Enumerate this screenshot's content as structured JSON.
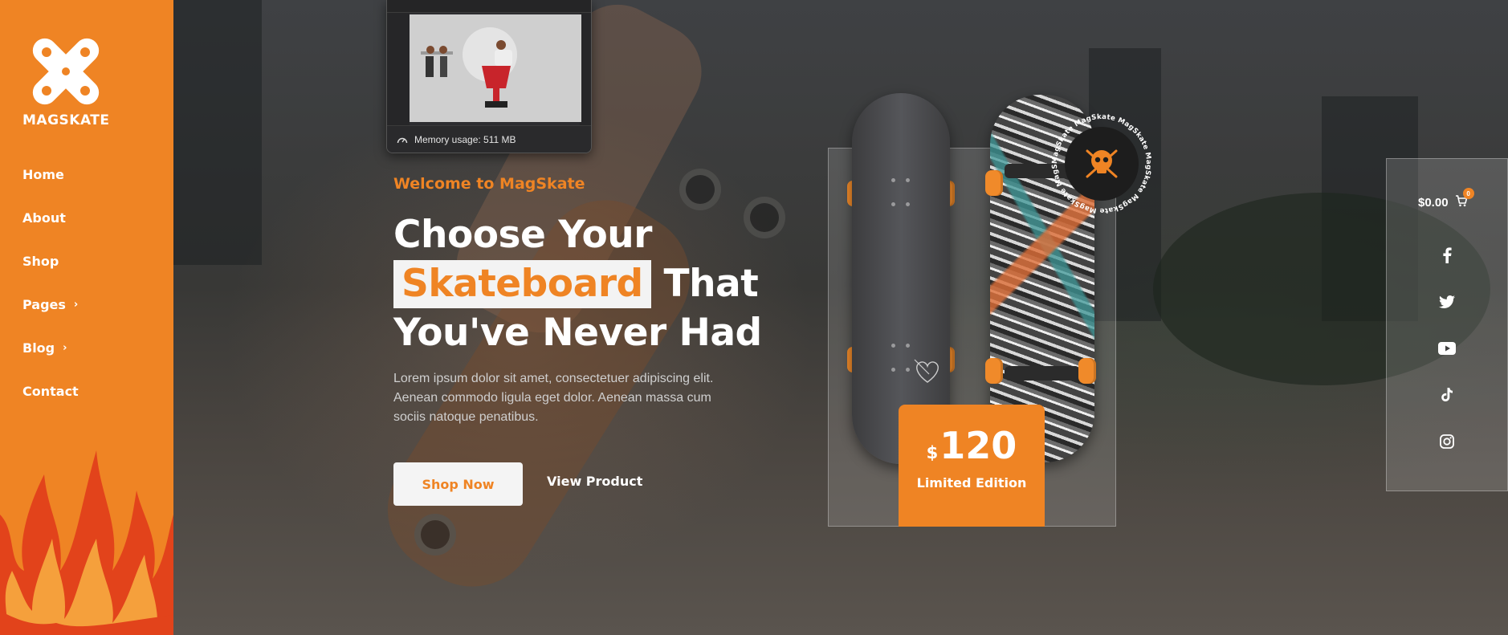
{
  "brand": {
    "name": "MAGSKATE"
  },
  "nav": {
    "items": [
      {
        "label": "Home"
      },
      {
        "label": "About"
      },
      {
        "label": "Shop"
      },
      {
        "label": "Pages"
      },
      {
        "label": "Blog"
      },
      {
        "label": "Contact"
      }
    ]
  },
  "overlay": {
    "memory_label": "Memory usage: 511 MB"
  },
  "hero": {
    "eyebrow": "Welcome to MagSkate",
    "headline_line1": "Choose Your",
    "headline_highlight": "Skateboard",
    "headline_line2_rest": "That",
    "headline_line3": "You've Never Had",
    "description": "Lorem ipsum dolor sit amet, consectetuer adipiscing elit. Aenean commodo ligula eget dolor. Aenean massa cum sociis natoque penatibus.",
    "cta_primary": "Shop Now",
    "cta_secondary": "View Product"
  },
  "product": {
    "currency_symbol": "$",
    "price": "120",
    "label": "Limited Edition",
    "badge_text": "MagSkate MagSkate MagSkate MagSkate MagSkate MagSkate MagSkate "
  },
  "cart": {
    "total": "$0.00",
    "count": "0"
  },
  "social": [
    "facebook-icon",
    "twitter-icon",
    "youtube-icon",
    "tiktok-icon",
    "instagram-icon"
  ],
  "colors": {
    "accent": "#ef8424",
    "flame_dark": "#e2431b",
    "flame_light": "#f5a03c"
  }
}
